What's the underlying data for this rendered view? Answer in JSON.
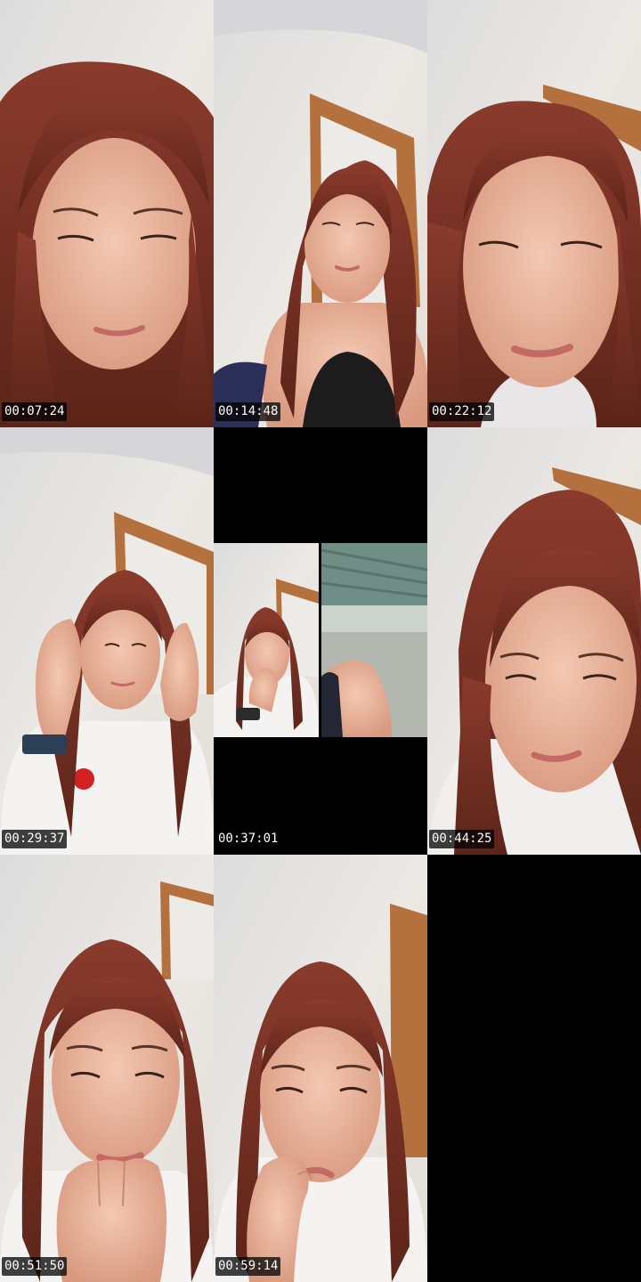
{
  "thumbnails": [
    {
      "timestamp": "00:07:24",
      "scene": "closeup-face"
    },
    {
      "timestamp": "00:14:48",
      "scene": "doorway-tank-top"
    },
    {
      "timestamp": "00:22:12",
      "scene": "closeup-face"
    },
    {
      "timestamp": "00:29:37",
      "scene": "hands-on-head"
    },
    {
      "timestamp": "00:37:01",
      "scene": "split-screen-call"
    },
    {
      "timestamp": "00:44:25",
      "scene": "closeup-face"
    },
    {
      "timestamp": "00:51:50",
      "scene": "hand-at-chin"
    },
    {
      "timestamp": "00:59:14",
      "scene": "finger-at-lip"
    },
    {
      "timestamp": "",
      "scene": "empty"
    }
  ],
  "colors": {
    "background": "#000000",
    "wall": "#e9e6e2",
    "door_frame": "#b5713d",
    "hair": "#6e2f22",
    "skin": "#e8b39a",
    "stamp_text": "#ffffff"
  }
}
